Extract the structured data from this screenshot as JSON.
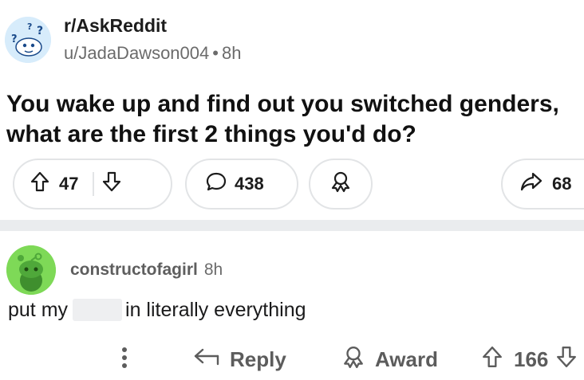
{
  "post": {
    "subreddit": "r/AskReddit",
    "author": "u/JadaDawson004",
    "separator": "•",
    "age": "8h",
    "title_line1": "You wake up and find out you switched genders,",
    "title_line2": "what are the first 2 things you'd do?",
    "upvotes": "47",
    "comments": "438",
    "shares": "68"
  },
  "comment": {
    "username": "constructofagirl",
    "age": "8h",
    "body_before": "put my",
    "body_after": "in literally everything",
    "actions": {
      "reply_label": "Reply",
      "award_label": "Award",
      "score": "166"
    }
  },
  "colors": {
    "subreddit_avatar_bg": "#d7ecfb",
    "user_avatar_bg": "#7ed957",
    "pill_border": "#e2e4e6",
    "divider": "#eaecee"
  },
  "icons": [
    "subreddit-avatar-icon",
    "upvote-icon",
    "downvote-icon",
    "comment-icon",
    "award-icon",
    "share-icon",
    "more-options-icon",
    "reply-icon"
  ]
}
